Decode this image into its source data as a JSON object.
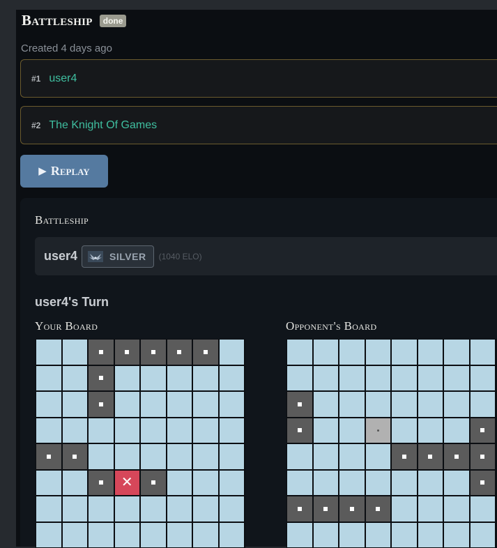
{
  "game": {
    "title": "Battleship",
    "status_badge": "done",
    "created": "Created 4 days ago"
  },
  "players": [
    {
      "num": "#1",
      "name": "user4"
    },
    {
      "num": "#2",
      "name": "The Knight Of Games"
    }
  ],
  "replay": {
    "icon": "play-icon",
    "label": "Replay"
  },
  "panel": {
    "title": "Battleship",
    "player": {
      "name": "user4",
      "rank_icon": "wings-rank-icon",
      "rank": "SILVER",
      "elo": "(1040 ELO)"
    },
    "turn": "user4's Turn"
  },
  "boards": {
    "own": {
      "label": "Your Board",
      "rows": [
        [
          "water",
          "water",
          "ship",
          "ship",
          "ship",
          "ship",
          "ship",
          "water"
        ],
        [
          "water",
          "water",
          "ship",
          "water",
          "water",
          "water",
          "water",
          "water"
        ],
        [
          "water",
          "water",
          "ship",
          "water",
          "water",
          "water",
          "water",
          "water"
        ],
        [
          "water",
          "water",
          "water",
          "water",
          "water",
          "water",
          "water",
          "water"
        ],
        [
          "ship",
          "ship",
          "water",
          "water",
          "water",
          "water",
          "water",
          "water"
        ],
        [
          "water",
          "water",
          "ship",
          "hit",
          "ship",
          "water",
          "water",
          "water"
        ],
        [
          "water",
          "water",
          "water",
          "water",
          "water",
          "water",
          "water",
          "water"
        ],
        [
          "water",
          "water",
          "water",
          "water",
          "water",
          "water",
          "water",
          "water"
        ]
      ]
    },
    "opponent": {
      "label": "Opponent's Board",
      "rows": [
        [
          "water",
          "water",
          "water",
          "water",
          "water",
          "water",
          "water",
          "water"
        ],
        [
          "water",
          "water",
          "water",
          "water",
          "water",
          "water",
          "water",
          "water"
        ],
        [
          "ship",
          "water",
          "water",
          "water",
          "water",
          "water",
          "water",
          "water"
        ],
        [
          "ship",
          "water",
          "water",
          "miss",
          "water",
          "water",
          "water",
          "ship"
        ],
        [
          "water",
          "water",
          "water",
          "water",
          "ship",
          "ship",
          "ship",
          "ship"
        ],
        [
          "water",
          "water",
          "water",
          "water",
          "water",
          "water",
          "water",
          "ship"
        ],
        [
          "ship",
          "ship",
          "ship",
          "ship",
          "water",
          "water",
          "water",
          "water"
        ],
        [
          "water",
          "water",
          "water",
          "water",
          "water",
          "water",
          "water",
          "water"
        ]
      ]
    }
  },
  "colors": {
    "water": "#b7d6e4",
    "ship": "#5b5b5b",
    "hit": "#d6475a",
    "miss": "#b1b1b1",
    "player_name": "#3fbfa0",
    "replay_button": "#557aa0"
  }
}
